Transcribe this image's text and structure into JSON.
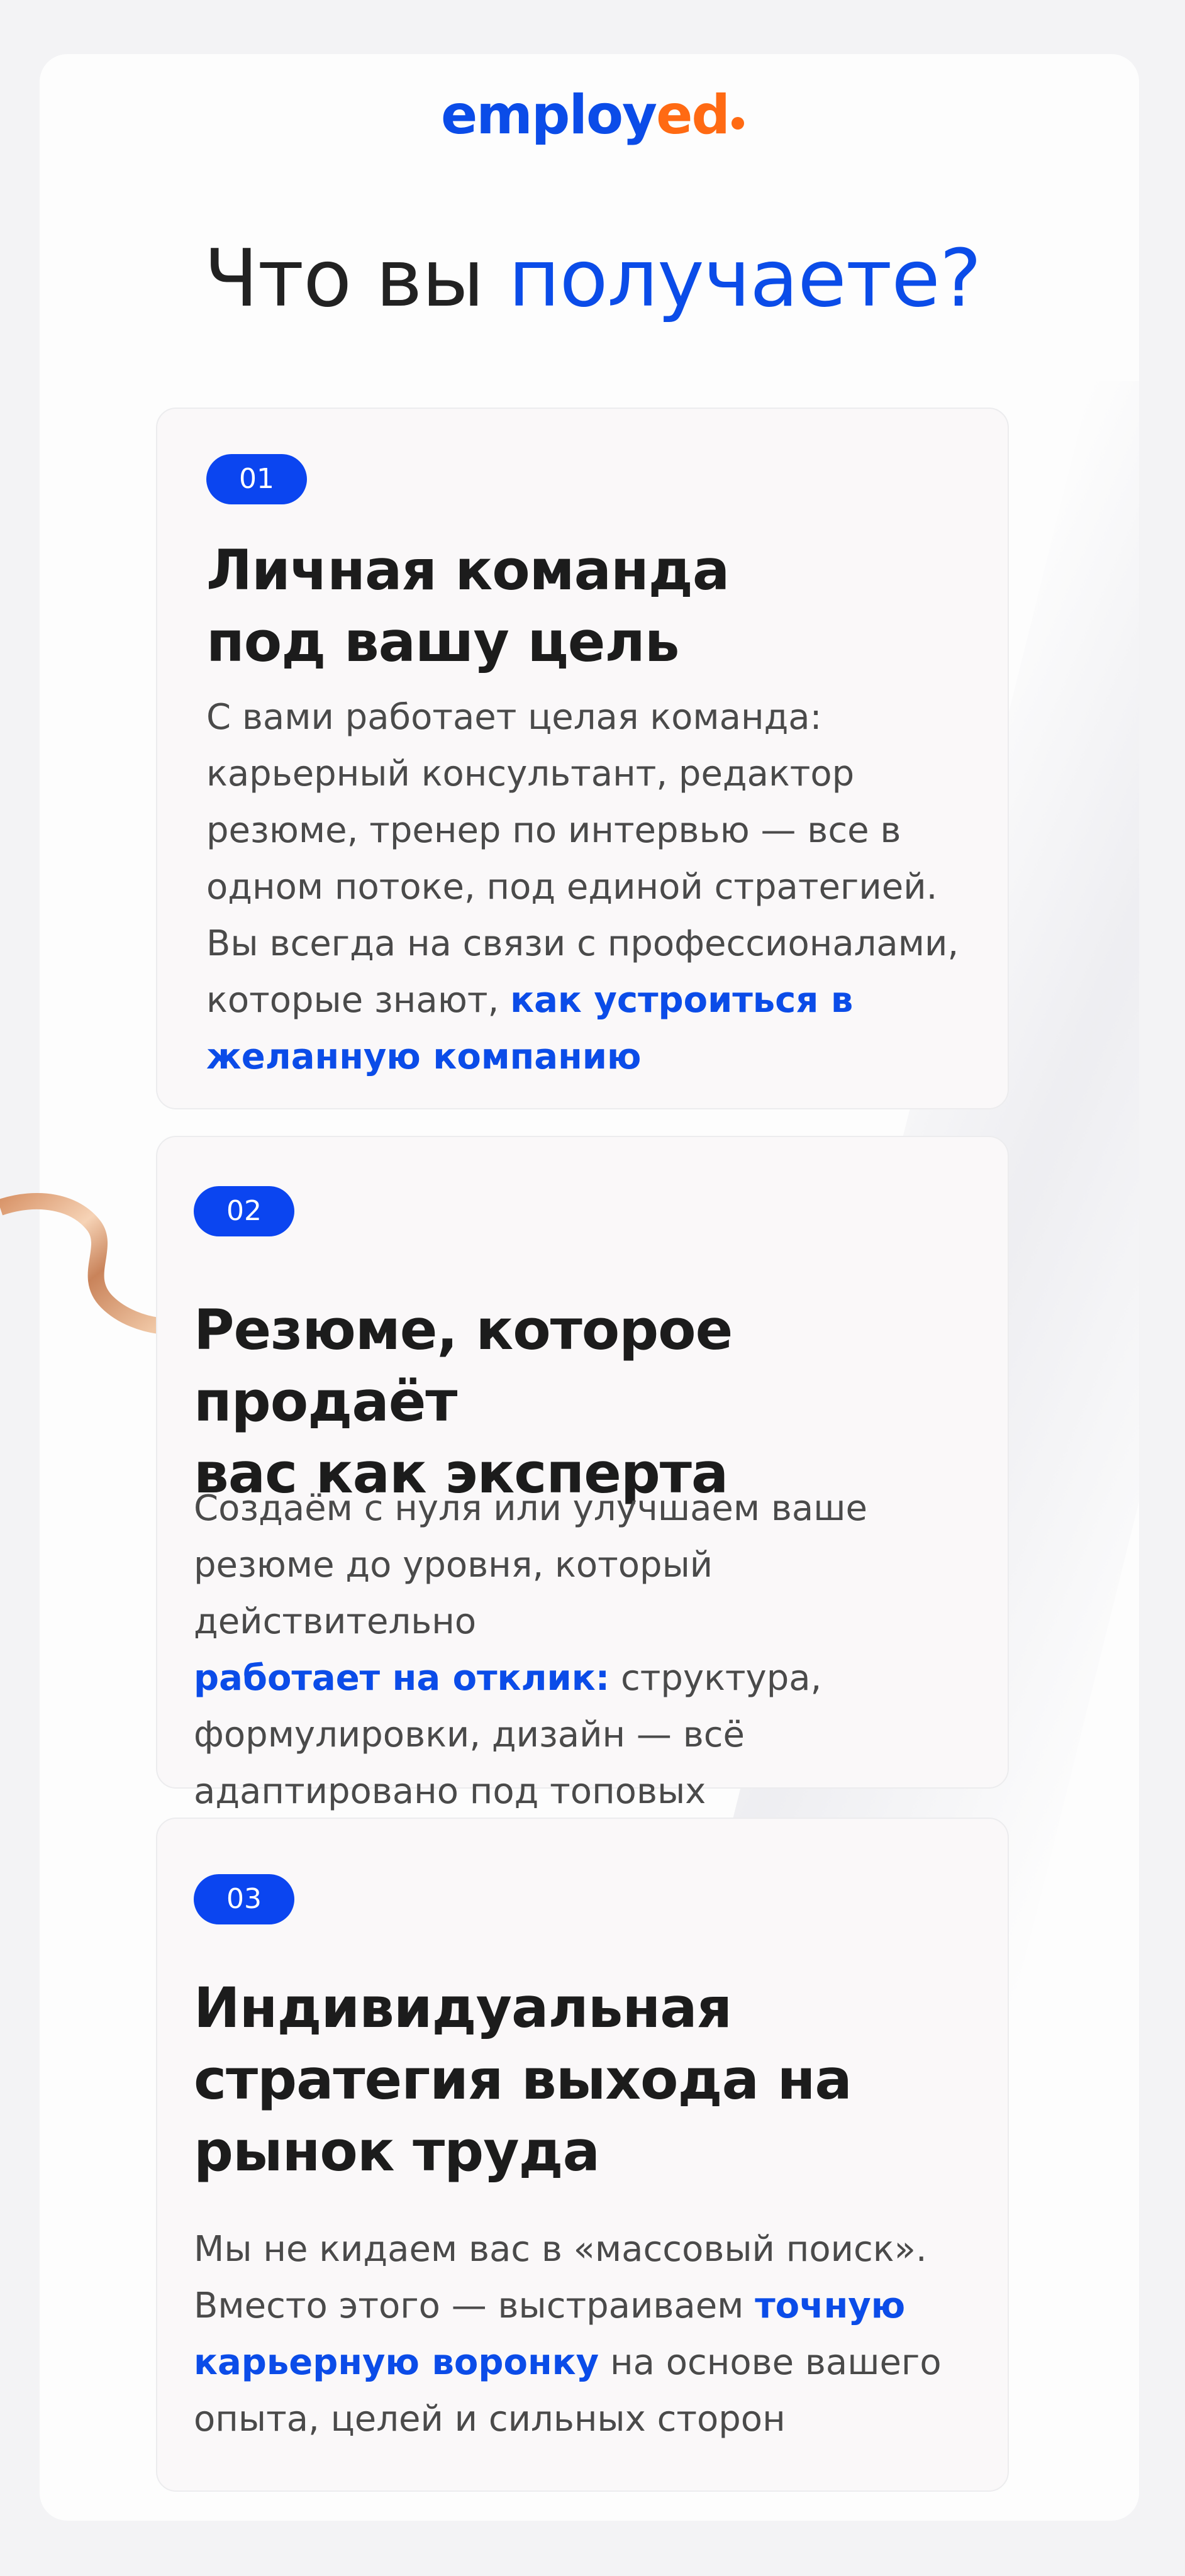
{
  "brand": {
    "logo_main": "employ",
    "logo_accent": "ed",
    "color_primary": "#0b4ce8",
    "color_accent": "#ff6a13"
  },
  "heading": {
    "part1": "Что вы ",
    "part2": "получаете?"
  },
  "cards": [
    {
      "badge": "01",
      "title": "Личная команда\nпод вашу цель",
      "body_plain": "С вами работает целая команда:\nкарьерный консультант, редактор\nрезюме, тренер по интервью — все в\nодном потоке, под единой стратегией.\nВы всегда на связи с профессионалами,\nкоторые знают, ",
      "body_highlight": "как устроиться в\nжеланную компанию",
      "body_tail": ""
    },
    {
      "badge": "02",
      "title": "Резюме, которое продаёт\nвас как эксперта",
      "body_plain": "Создаём с нуля или улучшаем ваше\nрезюме до уровня, который действительно\n",
      "body_highlight": "работает на отклик:",
      "body_tail": " структура,\nформулировки, дизайн — всё\nадаптировано под топовых работодателей"
    },
    {
      "badge": "03",
      "title": "Индивидуальная\nстратегия выхода на\nрынок труда",
      "body_plain": "Мы не кидаем вас в «массовый поиск».\nВместо этого — выстраиваем ",
      "body_highlight": "точную\nкарьерную воронку",
      "body_tail": " на основе вашего\nопыта, целей и сильных сторон"
    }
  ]
}
